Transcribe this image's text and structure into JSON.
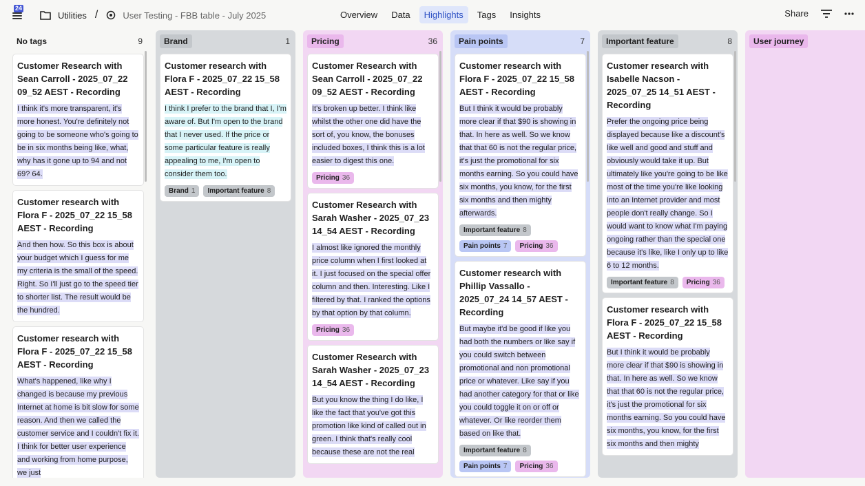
{
  "topbar": {
    "badge": "24",
    "crumb1": "Utilities",
    "crumb2": "User Testing - FBB table - July 2025",
    "tabs": [
      "Overview",
      "Data",
      "Highlights",
      "Tags",
      "Insights"
    ],
    "active_tab": "Highlights",
    "share": "Share"
  },
  "columns": [
    {
      "name": "No tags",
      "count": "9",
      "bg": "#f7f7f5",
      "label_bg": "transparent",
      "hl": "#dcdcf7",
      "cards": [
        {
          "title": "Customer Research with Sean Carroll - 2025_07_22 09_52 AEST - Recording",
          "body": "I think it's more transparent, it's more honest. You're definitely not going to be someone who's going to be in six months being like, what, why has it gone up to 94 and not 69? 64.",
          "tags": []
        },
        {
          "title": "Customer research with Flora F - 2025_07_22 15_58 AEST - Recording",
          "body": "And then how. So this box is about your budget which I guess for me my criteria is the small of the speed. Right. So I'll just go to the speed tier to shorter list. The result would be the hundred.",
          "tags": []
        },
        {
          "title": "Customer research with Flora F - 2025_07_22 15_58 AEST - Recording",
          "body": "What's happened, like why I changed is because my previous Internet at home is bit slow for some reason. And then we called the customer service and I couldn't fix it. I think for better user experience and working from home purpose, we just",
          "tags": []
        }
      ]
    },
    {
      "name": "Brand",
      "count": "1",
      "bg": "#d6d9dc",
      "label_bg": "#c3c7cb",
      "hl": "#d7f3f7",
      "cards": [
        {
          "title": "Customer research with Flora F - 2025_07_22 15_58 AEST - Recording",
          "body": "I think I prefer to the brand that I, I'm aware of. But I'm open to the brand that I never used. If the price or some particular feature is really appealing to me, I'm open to consider them too.",
          "tags": [
            {
              "name": "Brand",
              "n": "1"
            },
            {
              "name": "Important feature",
              "n": "8"
            }
          ]
        }
      ]
    },
    {
      "name": "Pricing",
      "count": "36",
      "bg": "#f2d7f3",
      "label_bg": "#eab8ec",
      "hl": "#dcdcf7",
      "cards": [
        {
          "title": "Customer Research with Sean Carroll - 2025_07_22 09_52 AEST - Recording",
          "body": "It's broken up better. I think like whilst the other one did have the sort of, you know, the bonuses included boxes, I think this is a lot easier to digest this one.",
          "tags": [
            {
              "name": "Pricing",
              "n": "36"
            }
          ]
        },
        {
          "title": "Customer Research with Sarah Washer - 2025_07_23 14_54 AEST - Recording",
          "body": "I almost like ignored the monthly price column when I first looked at it. I just focused on the special offer column and then. Interesting. Like I filtered by that. I ranked the options by that option by that column.",
          "tags": [
            {
              "name": "Pricing",
              "n": "36"
            }
          ]
        },
        {
          "title": "Customer Research with Sarah Washer - 2025_07_23 14_54 AEST - Recording",
          "body": "But you know the thing I do like, I like the fact that you've got this promotion like kind of called out in green. I think that's really cool because these are not the real",
          "tags": []
        }
      ]
    },
    {
      "name": "Pain points",
      "count": "7",
      "bg": "#d6ddf8",
      "label_bg": "#b9c6f4",
      "hl": "#dcdcf7",
      "cards": [
        {
          "title": "Customer research with Flora F - 2025_07_22 15_58 AEST - Recording",
          "body": "But I think it would be probably more clear if that $90 is showing in that. In here as well. So we know that that 60 is not the regular price, it's just the promotional for six months earning. So you could have six months, you know, for the first six months and then mighty afterwards.",
          "tags": [
            {
              "name": "Important feature",
              "n": "8"
            },
            {
              "name": "Pain points",
              "n": "7"
            },
            {
              "name": "Pricing",
              "n": "36"
            }
          ]
        },
        {
          "title": "Customer research with Phillip Vassallo - 2025_07_24 14_57 AEST - Recording",
          "body": "But maybe it'd be good if like you had both the numbers or like say if you could switch between promotional and non promotional price or whatever. Like say if you had another category for that or like you could toggle it on or off or whatever. Or like reorder them based on like that.",
          "tags": [
            {
              "name": "Important feature",
              "n": "8"
            },
            {
              "name": "Pain points",
              "n": "7"
            },
            {
              "name": "Pricing",
              "n": "36"
            }
          ]
        }
      ]
    },
    {
      "name": "Important feature",
      "count": "8",
      "bg": "#d6d9dc",
      "label_bg": "#c3c7cb",
      "hl": "#dcdcf7",
      "cards": [
        {
          "title": "Customer research with Isabelle Nacson - 2025_07_25 14_51 AEST - Recording",
          "body": "Prefer the ongoing price being displayed because like a discount's like well and good and stuff and obviously would take it up. But ultimately like you're going to be like most of the time you're like looking into an Internet provider and most people don't really change. So I would want to know what I'm paying ongoing rather than the special one because it's like, like I only up to like 6 to 12 months.",
          "tags": [
            {
              "name": "Important feature",
              "n": "8"
            },
            {
              "name": "Pricing",
              "n": "36"
            }
          ]
        },
        {
          "title": "Customer research with Flora F - 2025_07_22 15_58 AEST - Recording",
          "body": "But I think it would be probably more clear if that $90 is showing in that. In here as well. So we know that that 60 is not the regular price, it's just the promotional for six months earning. So you could have six months, you know, for the first six months and then mighty",
          "tags": []
        }
      ]
    },
    {
      "name": "User journey",
      "count": "",
      "bg": "#f2d7f3",
      "label_bg": "#eab8ec",
      "hl": "#dcdcf7",
      "cards": []
    }
  ],
  "tag_colors": {
    "Brand": "#c3c7cb",
    "Important feature": "#c3c7cb",
    "Pricing": "#eab8ec",
    "Pain points": "#b9c6f4"
  }
}
